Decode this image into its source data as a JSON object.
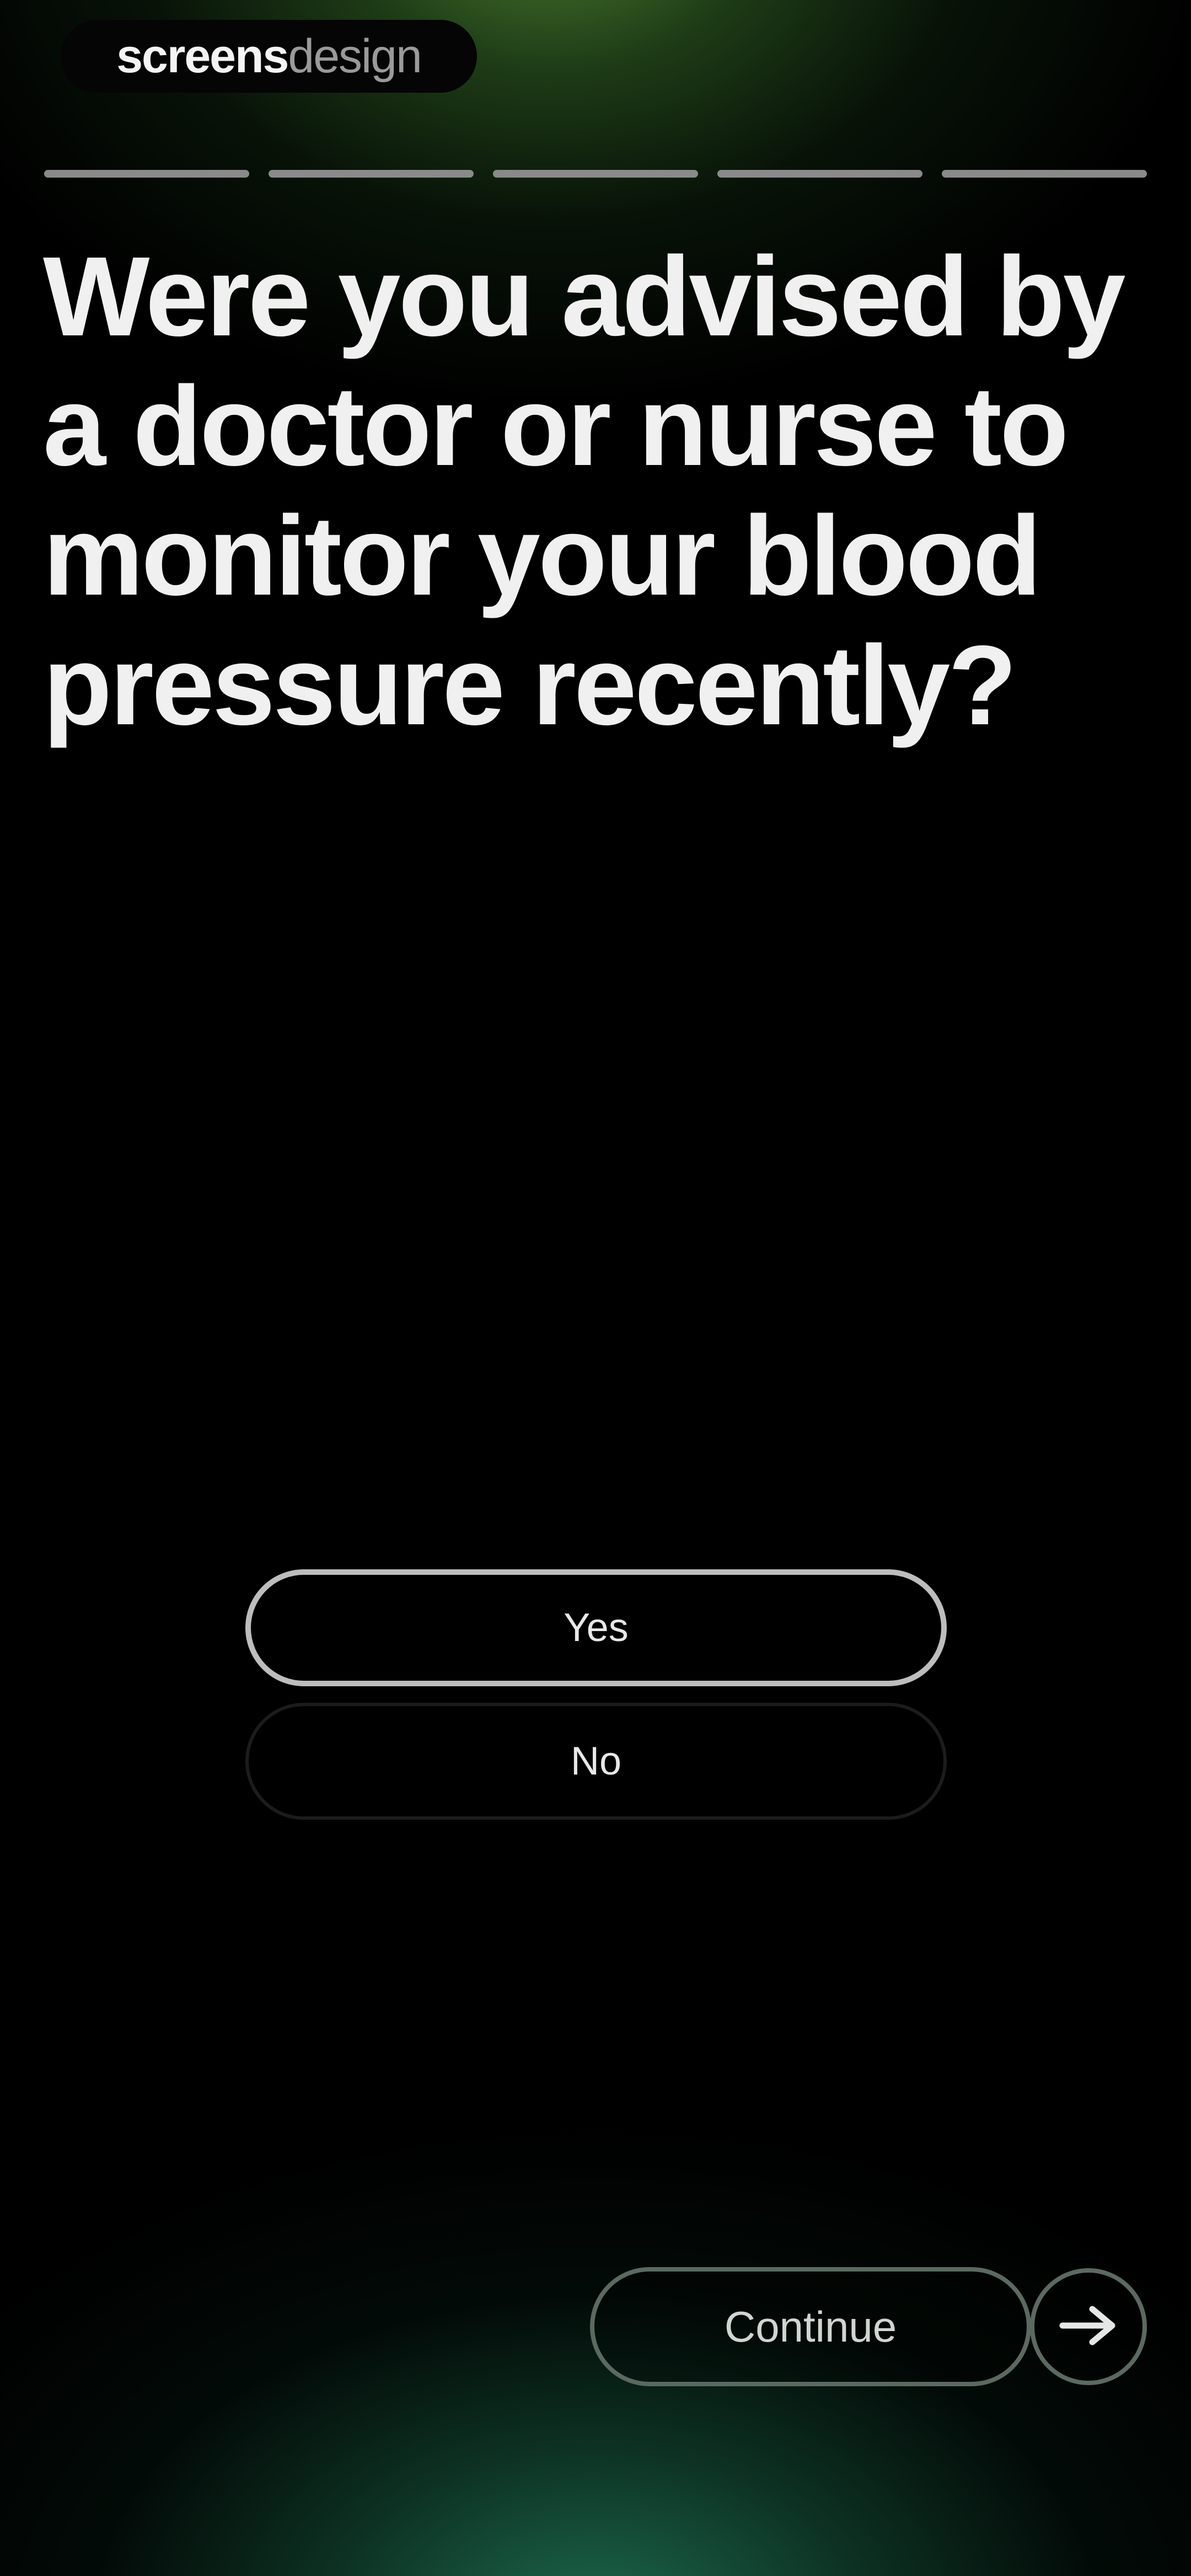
{
  "brand": {
    "part_bold": "screens",
    "part_light": "design"
  },
  "progress": {
    "total_steps": 5,
    "completed_steps": 5
  },
  "question": {
    "text": "Were you advised by a doctor or nurse to monitor your blood pressure recently?"
  },
  "options": [
    {
      "label": "Yes",
      "selected": true
    },
    {
      "label": "No",
      "selected": false
    }
  ],
  "footer": {
    "continue_label": "Continue",
    "next_icon": "arrow-right-icon"
  },
  "colors": {
    "background": "#000000",
    "top_glow": "#50823a",
    "bottom_glow": "#1e6e50",
    "text": "#f0f0f0",
    "selected_border": "#bdbdbd"
  }
}
